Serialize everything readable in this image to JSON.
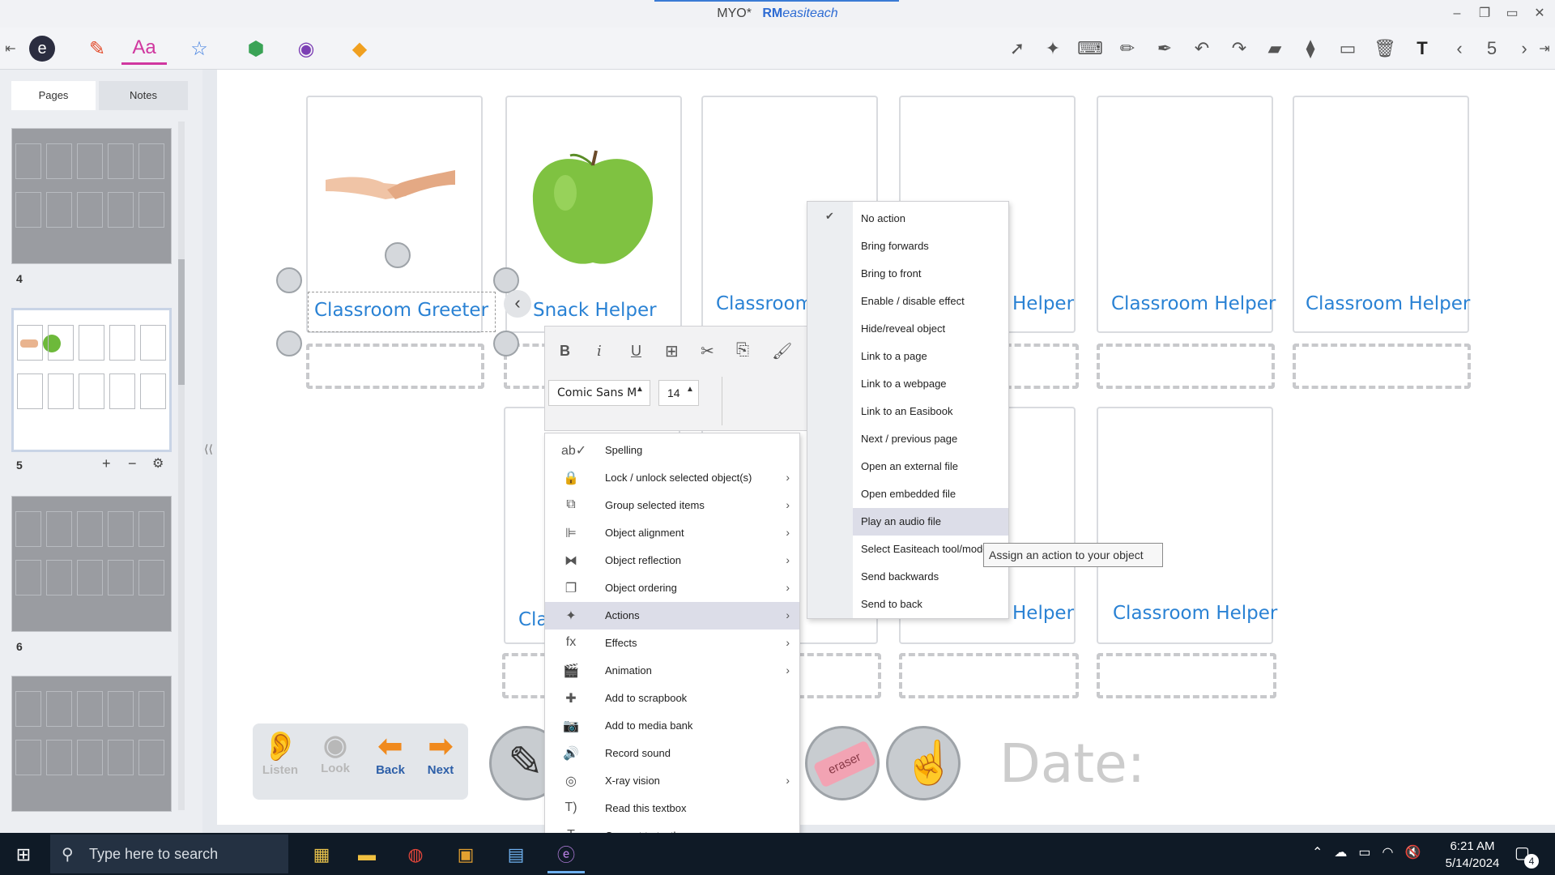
{
  "window": {
    "title_prefix": "MYO*",
    "brand": "RM",
    "brand_rest": "easiteach",
    "minimize": "–",
    "restore": "❐",
    "maximize": "▭",
    "close": "✕"
  },
  "toolbar": {
    "left": [
      {
        "name": "collapse-left-icon",
        "glyph": "⇤"
      },
      {
        "name": "easiteach-logo-icon",
        "glyph": "e"
      },
      {
        "name": "pen-tool-icon",
        "glyph": "✎"
      },
      {
        "name": "text-tool-icon",
        "glyph": "Aa"
      },
      {
        "name": "star-tool-icon",
        "glyph": "☆"
      },
      {
        "name": "fill-tool-icon",
        "glyph": "⬢"
      },
      {
        "name": "camera-tool-icon",
        "glyph": "◉"
      },
      {
        "name": "shapes-tool-icon",
        "glyph": "◆"
      }
    ],
    "right": [
      {
        "name": "select-pointer-icon",
        "glyph": "➚"
      },
      {
        "name": "magic-select-icon",
        "glyph": "✦"
      },
      {
        "name": "keyboard-icon",
        "glyph": "⌨"
      },
      {
        "name": "highlighter-icon",
        "glyph": "✏"
      },
      {
        "name": "marker-icon",
        "glyph": "✒"
      },
      {
        "name": "undo-icon",
        "glyph": "↶"
      },
      {
        "name": "redo-icon",
        "glyph": "↷"
      },
      {
        "name": "eraser-icon",
        "glyph": "▰"
      },
      {
        "name": "clear-eraser-icon",
        "glyph": "⧫"
      },
      {
        "name": "display-icon",
        "glyph": "▭"
      },
      {
        "name": "delete-icon",
        "glyph": "🗑"
      },
      {
        "name": "text-mode-icon",
        "glyph": "T"
      },
      {
        "name": "prev-page-icon",
        "glyph": "‹"
      },
      {
        "name": "page-number",
        "glyph": "5"
      },
      {
        "name": "next-page-icon",
        "glyph": "›"
      },
      {
        "name": "collapse-right-icon",
        "glyph": "⇥"
      }
    ]
  },
  "sidebar": {
    "tabs": {
      "pages": "Pages",
      "notes": "Notes"
    },
    "thumbnails": [
      {
        "label": "4"
      },
      {
        "label": "5"
      },
      {
        "label": "6"
      },
      {
        "label": ""
      }
    ],
    "page_controls": {
      "add": "+",
      "remove": "−",
      "settings": "⚙"
    },
    "collapse": "⟨⟨"
  },
  "cards": {
    "row1": [
      "Classroom Greeter",
      "Snack Helper",
      "Classroom",
      "Helper",
      "Classroom Helper",
      "Classroom Helper"
    ],
    "row2": [
      "Cla",
      "Helper",
      "Classroom Helper"
    ]
  },
  "format_bar": {
    "bold": "B",
    "italic": "i",
    "underline": "U",
    "font_name": "Comic Sans M",
    "font_size": "14",
    "up_arrow": "▲",
    "back": "‹"
  },
  "context_menu": [
    {
      "icon": "ab✓",
      "name": "spelling-icon",
      "label": "Spelling",
      "submenu": false
    },
    {
      "icon": "🔒",
      "name": "lock-icon",
      "label": "Lock / unlock selected object(s)",
      "submenu": true
    },
    {
      "icon": "⧉",
      "name": "group-icon",
      "label": "Group selected items",
      "submenu": true
    },
    {
      "icon": "⊫",
      "name": "alignment-icon",
      "label": "Object alignment",
      "submenu": true
    },
    {
      "icon": "⧓",
      "name": "reflection-icon",
      "label": "Object reflection",
      "submenu": true
    },
    {
      "icon": "❐",
      "name": "ordering-icon",
      "label": "Object ordering",
      "submenu": true
    },
    {
      "icon": "✦",
      "name": "actions-icon",
      "label": "Actions",
      "submenu": true
    },
    {
      "icon": "fx",
      "name": "effects-icon",
      "label": "Effects",
      "submenu": true
    },
    {
      "icon": "🎬",
      "name": "animation-icon",
      "label": "Animation",
      "submenu": true
    },
    {
      "icon": "✚",
      "name": "scrapbook-icon",
      "label": "Add to scrapbook",
      "submenu": false
    },
    {
      "icon": "📷",
      "name": "media-bank-icon",
      "label": "Add to media bank",
      "submenu": false
    },
    {
      "icon": "🔊",
      "name": "record-sound-icon",
      "label": "Record sound",
      "submenu": false
    },
    {
      "icon": "◎",
      "name": "xray-icon",
      "label": "X-ray vision",
      "submenu": true
    },
    {
      "icon": "T)",
      "name": "read-textbox-icon",
      "label": "Read this textbox",
      "submenu": false
    },
    {
      "icon": "Ŧ",
      "name": "convert-textbox-icon",
      "label": "Convert to textbox",
      "submenu": false
    }
  ],
  "actions_menu": {
    "items": [
      "No action",
      "Bring forwards",
      "Bring to front",
      "Enable / disable effect",
      "Hide/reveal object",
      "Link to a page",
      "Link to a webpage",
      "Link to an Easibook",
      "Next / previous page",
      "Open an external file",
      "Open embedded file",
      "Play an audio file",
      "Select Easiteach tool/mode",
      "Send backwards",
      "Send to back"
    ],
    "checked": "No action",
    "highlighted": "Play an audio file",
    "check_glyph": "✔"
  },
  "tooltip": "Assign an action to your object",
  "bottom_panel": {
    "listen": "Listen",
    "look": "Look",
    "back": "Back",
    "next": "Next"
  },
  "eraser_label": "eraser",
  "date_label": "Date:",
  "taskbar": {
    "search_placeholder": "Type here to search",
    "time": "6:21 AM",
    "date": "5/14/2024",
    "notification_count": "4"
  },
  "colors": {
    "accent": "#2a82d4",
    "menu_highlight": "#dcdde8",
    "taskbar": "#0f1a26"
  }
}
